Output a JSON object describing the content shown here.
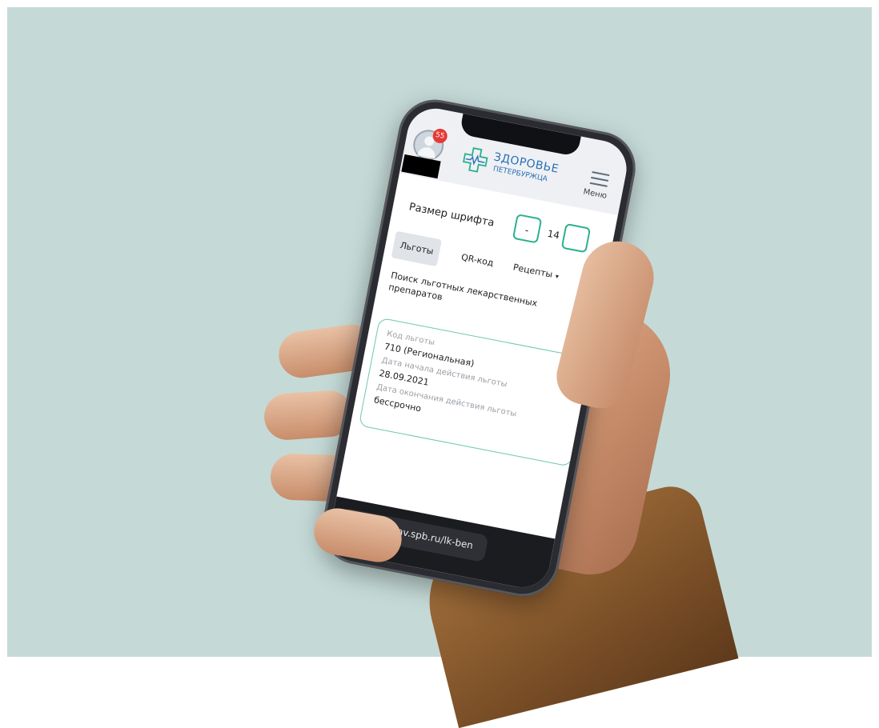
{
  "header": {
    "notification_count": "55",
    "logo_line1": "ЗДОРОВЬЕ",
    "logo_line2": "ПЕТЕРБУРЖЦА",
    "menu_label": "Меню"
  },
  "font_size": {
    "label": "Размер шрифта",
    "minus_label": "-",
    "value": "14"
  },
  "tabs": [
    {
      "label": "Льготы",
      "active": true
    },
    {
      "label": "QR-код",
      "active": false
    },
    {
      "label": "Рецепты",
      "active": false,
      "caret": "▾"
    }
  ],
  "search_title": "Поиск льготных лекарственных препаратов",
  "benefit_card": {
    "code_label": "Код льготы",
    "code_value": "710 (Региональная)",
    "start_label": "Дата начала действия льготы",
    "start_value": "28.09.2021",
    "end_label": "Дата окончания действия льготы",
    "end_value": "бессрочно"
  },
  "browser": {
    "url": "gorzdrav.spb.ru/lk-ben"
  },
  "colors": {
    "background": "#c5dad7",
    "accent": "#2bb08f",
    "logo": "#2a6fb5",
    "badge": "#e53935"
  }
}
